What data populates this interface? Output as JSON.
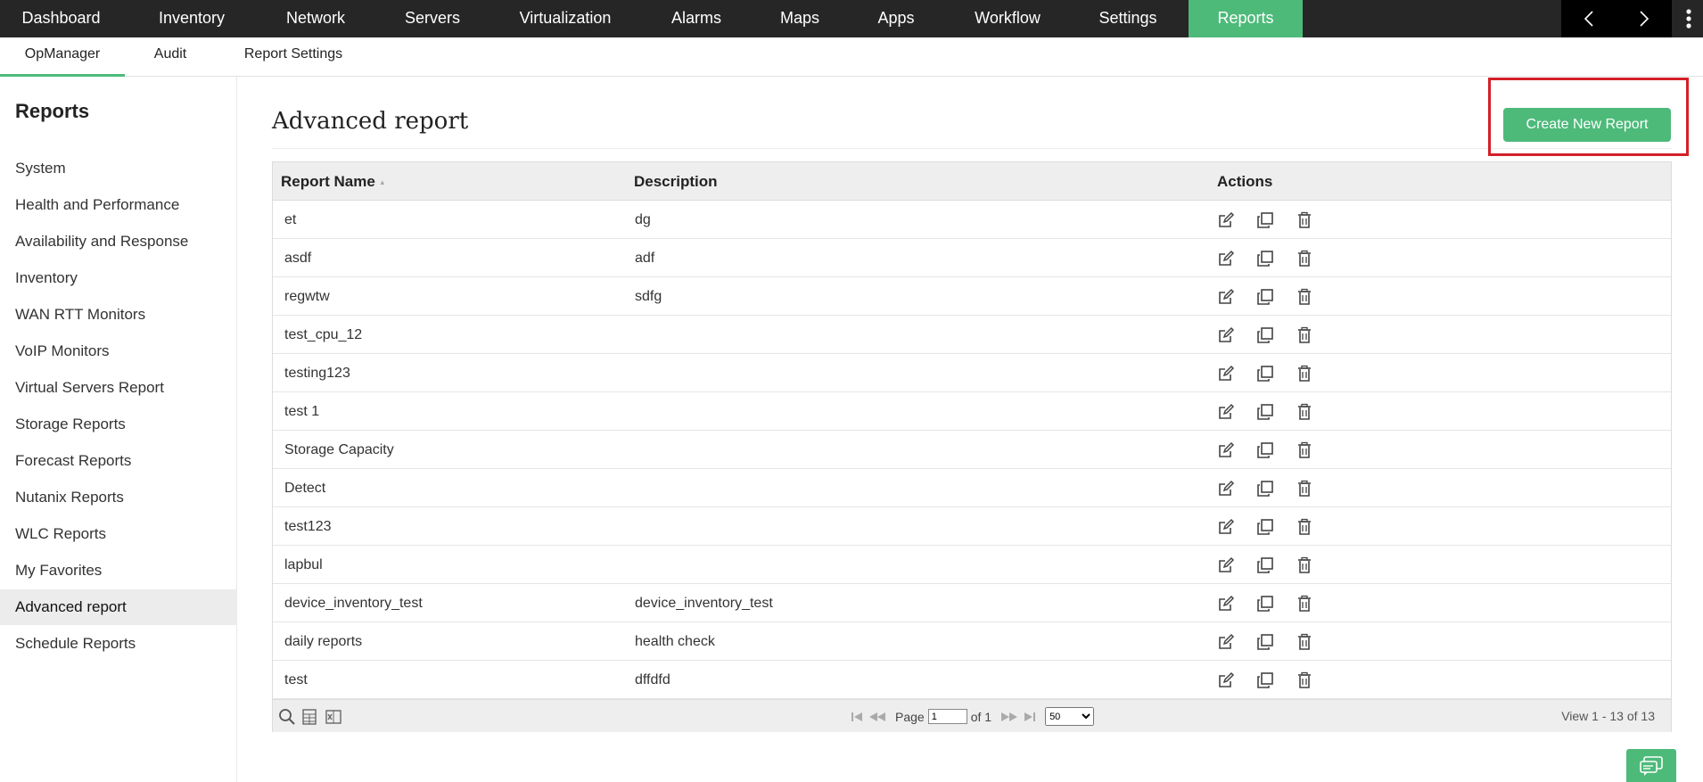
{
  "topnav": {
    "tabs": [
      {
        "label": "Dashboard"
      },
      {
        "label": "Inventory"
      },
      {
        "label": "Network"
      },
      {
        "label": "Servers"
      },
      {
        "label": "Virtualization"
      },
      {
        "label": "Alarms"
      },
      {
        "label": "Maps"
      },
      {
        "label": "Apps"
      },
      {
        "label": "Workflow"
      },
      {
        "label": "Settings"
      },
      {
        "label": "Reports",
        "active": true
      }
    ],
    "active_color": "#4dba7a",
    "background": "#262626",
    "icons": [
      "chevron-left-icon",
      "chevron-right-icon",
      "more-vertical-icon"
    ]
  },
  "subnav": {
    "tabs": [
      {
        "label": "OpManager",
        "active": true
      },
      {
        "label": "Audit"
      },
      {
        "label": "Report Settings"
      }
    ]
  },
  "sidebar": {
    "title": "Reports",
    "items": [
      {
        "label": "System"
      },
      {
        "label": "Health and Performance"
      },
      {
        "label": "Availability and Response"
      },
      {
        "label": "Inventory"
      },
      {
        "label": "WAN RTT Monitors"
      },
      {
        "label": "VoIP Monitors"
      },
      {
        "label": "Virtual Servers Report"
      },
      {
        "label": "Storage Reports"
      },
      {
        "label": "Forecast Reports"
      },
      {
        "label": "Nutanix Reports"
      },
      {
        "label": "WLC Reports"
      },
      {
        "label": "My Favorites"
      },
      {
        "label": "Advanced report",
        "active": true
      },
      {
        "label": "Schedule Reports"
      }
    ]
  },
  "main": {
    "title": "Advanced report",
    "create_button": "Create New Report",
    "highlight_color": "#d42027",
    "table": {
      "headers": {
        "name": "Report Name",
        "description": "Description",
        "actions": "Actions"
      },
      "sort_icon": "sort-asc-icon",
      "action_icons": [
        "edit-icon",
        "copy-icon",
        "trash-icon"
      ],
      "rows": [
        {
          "name": "et",
          "description": "dg"
        },
        {
          "name": "asdf",
          "description": "adf"
        },
        {
          "name": "regwtw",
          "description": "sdfg"
        },
        {
          "name": "test_cpu_12",
          "description": ""
        },
        {
          "name": "testing123",
          "description": ""
        },
        {
          "name": "test 1",
          "description": ""
        },
        {
          "name": "Storage Capacity",
          "description": ""
        },
        {
          "name": "Detect",
          "description": ""
        },
        {
          "name": "test123",
          "description": ""
        },
        {
          "name": "lapbul",
          "description": ""
        },
        {
          "name": "device_inventory_test",
          "description": "device_inventory_test"
        },
        {
          "name": "daily reports",
          "description": "health check"
        },
        {
          "name": "test",
          "description": "dffdfd"
        }
      ]
    },
    "pager": {
      "page_label": "Page",
      "page_value": "1",
      "of_label": "of 1",
      "page_size": "50",
      "view_info": "View 1 - 13 of 13",
      "footer_icons": [
        "search-icon",
        "csv-icon",
        "excel-icon"
      ]
    }
  }
}
